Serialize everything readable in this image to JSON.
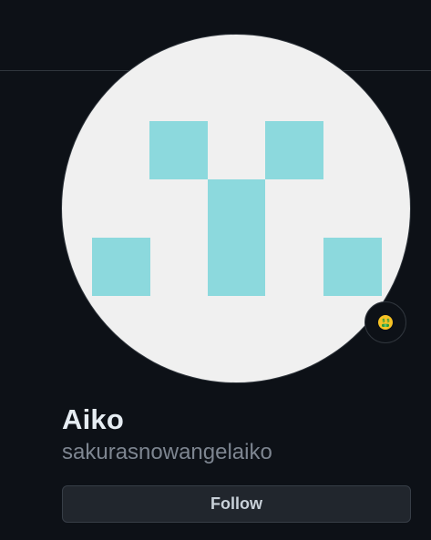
{
  "colors": {
    "page_background": "#0d1117",
    "avatar_background": "#f0f0f0",
    "identicon": "#8cd9dd",
    "button_background": "#21262d",
    "name_text": "#e6edf3",
    "username_text": "#7d8590"
  },
  "profile": {
    "avatar": {
      "icon": "identicon-avatar"
    },
    "status": {
      "icon": "money-mouth-face-icon"
    },
    "name": "Aiko",
    "username": "sakurasnowangelaiko",
    "follow_label": "Follow"
  }
}
